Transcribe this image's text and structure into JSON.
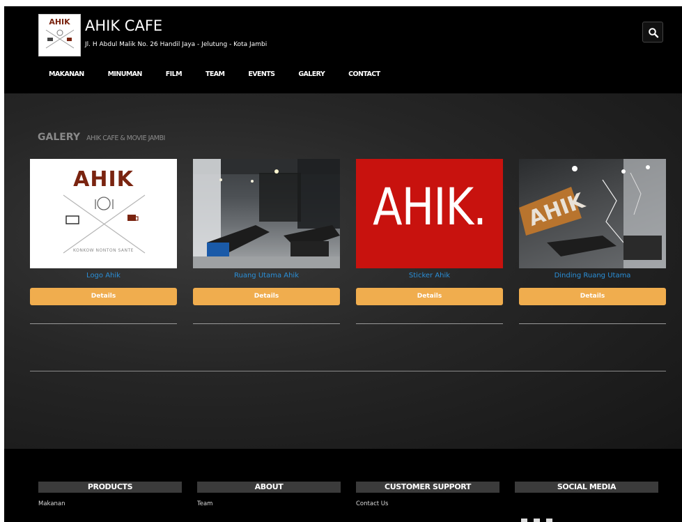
{
  "header": {
    "logo_text": "AHIK",
    "title": "AHIK CAFE",
    "address": "Jl. H Abdul Malik No. 26 Handil Jaya - Jelutung - Kota Jambi"
  },
  "nav": {
    "items": [
      "MAKANAN",
      "MINUMAN",
      "FILM",
      "TEAM",
      "EVENTS",
      "GALERY",
      "CONTACT"
    ]
  },
  "section": {
    "title": "GALERY",
    "subtitle": "AHIK CAFE & MOVIE JAMBI"
  },
  "cards": [
    {
      "title": "Logo Ahik",
      "button": "Details",
      "thumb_text": "AHIK",
      "thumb_caption": "KONKOW NONTON SANTE"
    },
    {
      "title": "Ruang Utama Ahik",
      "button": "Details"
    },
    {
      "title": "Sticker Ahik",
      "button": "Details",
      "thumb_text": "AHIK."
    },
    {
      "title": "Dinding Ruang Utama",
      "button": "Details",
      "thumb_text": "AHIK"
    }
  ],
  "footer": {
    "columns": [
      {
        "heading": "PRODUCTS",
        "link": "Makanan"
      },
      {
        "heading": "ABOUT",
        "link": "Team"
      },
      {
        "heading": "CUSTOMER SUPPORT",
        "link": "Contact Us"
      },
      {
        "heading": "SOCIAL MEDIA",
        "link": ""
      }
    ]
  },
  "colors": {
    "accent_button": "#f0ad4e",
    "link_blue": "#2a8fd8",
    "logo_brown": "#7a2410",
    "sticker_red": "#c8120e"
  },
  "icons": {
    "search": "search-icon",
    "social": [
      "facebook-icon",
      "twitter-icon",
      "youtube-icon"
    ]
  }
}
